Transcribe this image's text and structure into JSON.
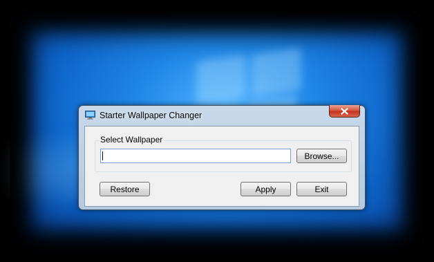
{
  "window": {
    "title": "Starter Wallpaper Changer",
    "icon": "monitor-icon"
  },
  "controls": {
    "close_icon": "close-icon"
  },
  "group": {
    "label": "Select Wallpaper",
    "path_value": "",
    "browse_label": "Browse..."
  },
  "actions": {
    "restore_label": "Restore",
    "apply_label": "Apply",
    "exit_label": "Exit"
  },
  "colors": {
    "close_button": "#c2301b",
    "desktop_blue": "#1e86e6"
  }
}
